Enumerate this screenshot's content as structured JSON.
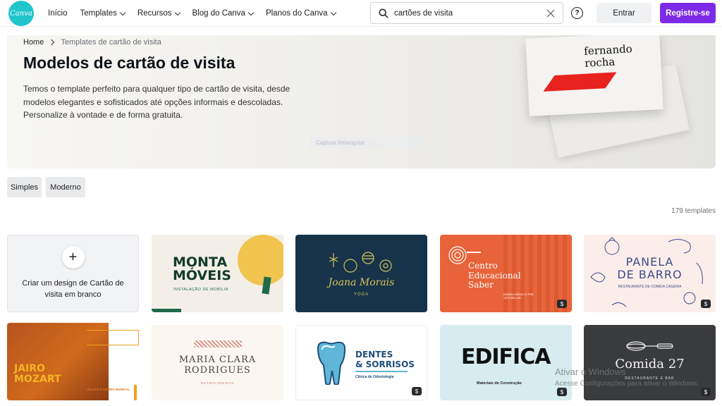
{
  "nav": {
    "logo_text": "Canva",
    "items": [
      "Início",
      "Templates",
      "Recursos",
      "Blog do Canva",
      "Planos do Canva"
    ],
    "search_value": "cartões de visita",
    "help_label": "?",
    "login_label": "Entrar",
    "signup_label": "Registre-se"
  },
  "breadcrumb": {
    "home": "Home",
    "current": "Templates de cartão de visita"
  },
  "hero": {
    "title": "Modelos de cartão de visita",
    "description": "Temos o template perfeito para qualquer tipo de cartão de visita, desde modelos elegantes e sofisticados até opções informais e descoladas. Personalize à vontade e de forma gratuita.",
    "capture_label": "Captura Retangular",
    "card_name_line1": "fernando",
    "card_name_line2": "rocha"
  },
  "filters": [
    "Simples",
    "Moderno"
  ],
  "count_label": "179 templates",
  "blank_card": {
    "plus": "+",
    "label": "Criar um design de Cartão de visita em branco"
  },
  "templates": {
    "monta": {
      "line1": "MONTA",
      "line2": "MÓVEIS",
      "tagline": "INSTALAÇÃO DE MOBÍLIA"
    },
    "joana": {
      "name": "Joana Morais",
      "tagline": "YOGA"
    },
    "centro": {
      "line1": "Centro",
      "line2": "Educacional",
      "line3": "Saber",
      "tagline": "ENSINO MÉDIO E PRÉ-VESTIBULAR"
    },
    "panela": {
      "line1": "PANELA",
      "line2": "DE BARRO",
      "tagline": "RESTAURANTE DE COMIDA CASEIRA"
    },
    "jairo": {
      "line1": "JAIRO",
      "line2": "MOZART",
      "tagline": "VIOLÃO E TEORIA MUSICAL"
    },
    "maria": {
      "line1": "MARIA CLARA",
      "line2": "RODRIGUES",
      "tagline": "NUTRICIONISTA"
    },
    "dentes": {
      "line1": "DENTES",
      "line2": "& SORRISOS",
      "tagline": "Clínica de Odontologia"
    },
    "edifica": {
      "name": "EDIFICA",
      "tagline": "Materiais de Construção"
    },
    "comida": {
      "name": "Comida 27",
      "tagline": "RESTAURANTE E BAR"
    },
    "pro_badge": "$"
  },
  "watermark": {
    "line1": "Ativar o Windows",
    "line2": "Acesse Configurações para ativar o Windows."
  }
}
